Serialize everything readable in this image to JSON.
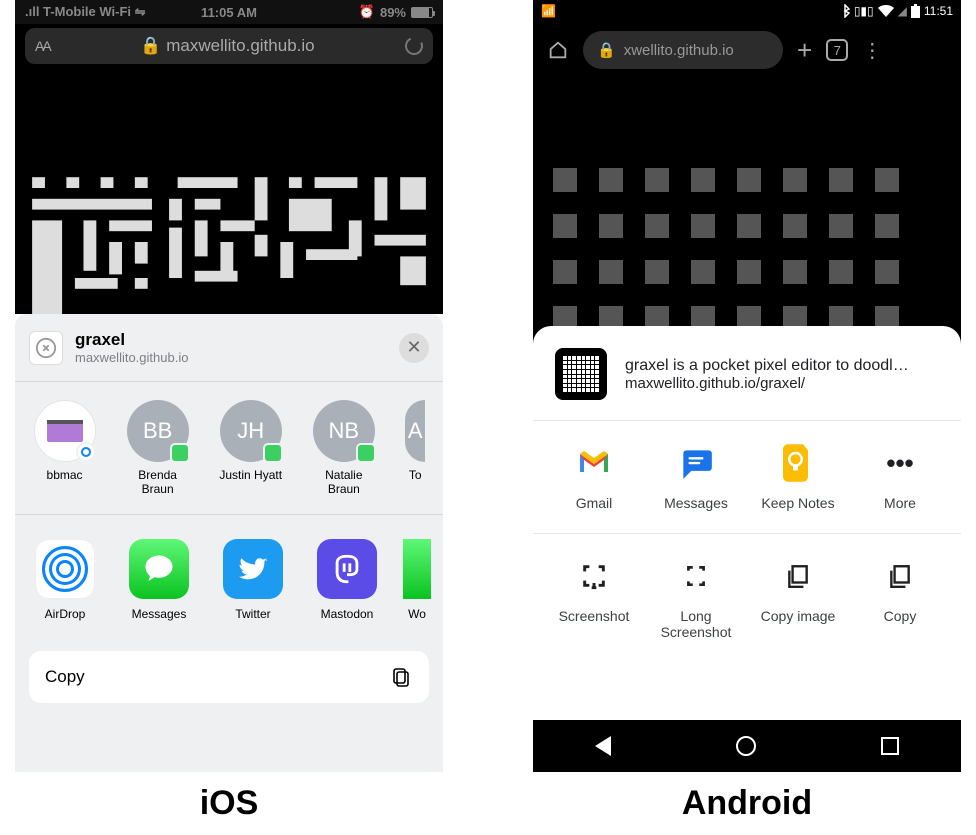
{
  "captions": {
    "ios": "iOS",
    "android": "Android"
  },
  "ios": {
    "status": {
      "carrier": ".ıll T-Mobile Wi-Fi ⇋",
      "time": "11:05 AM",
      "battery": "89%",
      "alarm": "⏰"
    },
    "addressbar": {
      "textmode": "AA",
      "url": "maxwellito.github.io"
    },
    "sheet": {
      "title": "graxel",
      "subtitle": "maxwellito.github.io",
      "contacts": [
        {
          "initials": "",
          "name": "bbmac",
          "avatar": "mac"
        },
        {
          "initials": "BB",
          "name": "Brenda Braun",
          "badge": "imsg"
        },
        {
          "initials": "JH",
          "name": "Justin Hyatt",
          "badge": "imsg"
        },
        {
          "initials": "NB",
          "name": "Natalie Braun",
          "badge": "imsg"
        },
        {
          "initials": "A",
          "name": "To",
          "badge": ""
        }
      ],
      "apps": [
        {
          "name": "AirDrop",
          "kind": "airdrop"
        },
        {
          "name": "Messages",
          "kind": "imsg"
        },
        {
          "name": "Twitter",
          "kind": "tw"
        },
        {
          "name": "Mastodon",
          "kind": "ms"
        },
        {
          "name": "Wo",
          "kind": "part"
        }
      ],
      "copy": "Copy"
    }
  },
  "android": {
    "status": {
      "time": "11:51"
    },
    "addressbar": {
      "url": "xwellito.github.io",
      "tabs": "7"
    },
    "sheet": {
      "title": "graxel is a pocket pixel editor to doodl…",
      "subtitle": "maxwellito.github.io/graxel/",
      "apps": [
        {
          "name": "Gmail"
        },
        {
          "name": "Messages"
        },
        {
          "name": "Keep Notes"
        },
        {
          "name": "More"
        }
      ],
      "actions": [
        {
          "name": "Screenshot"
        },
        {
          "name": "Long Screenshot"
        },
        {
          "name": "Copy image"
        },
        {
          "name": "Copy"
        }
      ]
    }
  }
}
